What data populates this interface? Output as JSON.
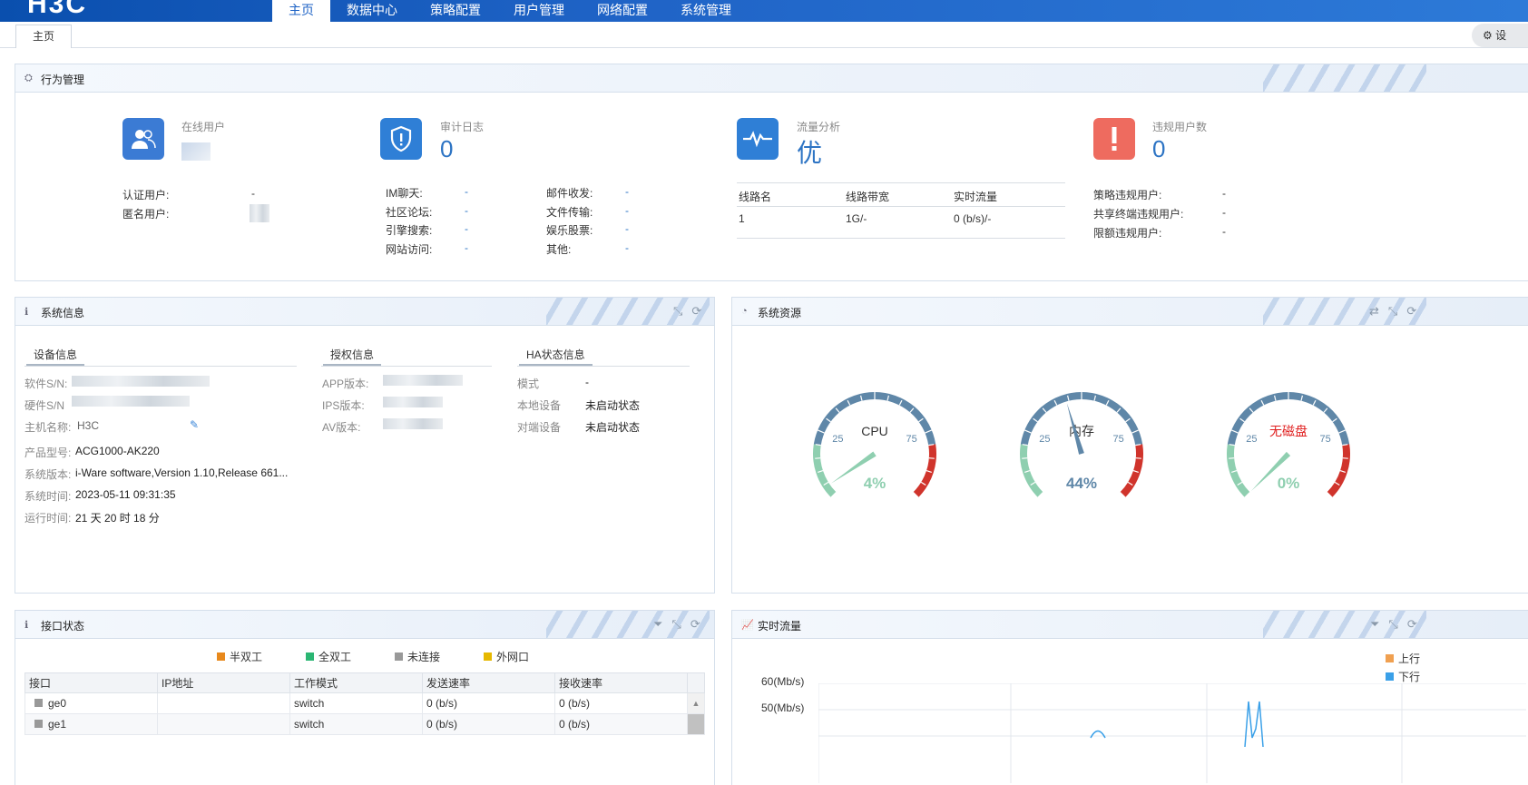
{
  "app": {
    "logo": "H3C"
  },
  "nav": {
    "items": [
      "主页",
      "数据中心",
      "策略配置",
      "用户管理",
      "网络配置",
      "系统管理"
    ],
    "active_index": 0
  },
  "tabs": {
    "current": "主页",
    "settings_label": "设"
  },
  "behavior": {
    "title": "行为管理",
    "online_users": {
      "label": "在线用户",
      "auth_label": "认证用户:",
      "auth_value": "-",
      "anon_label": "匿名用户:"
    },
    "audit": {
      "label": "审计日志",
      "value": "0",
      "items": [
        {
          "label": "IM聊天:",
          "value": "-"
        },
        {
          "label": "社区论坛:",
          "value": "-"
        },
        {
          "label": "引擎搜索:",
          "value": "-"
        },
        {
          "label": "网站访问:",
          "value": "-"
        },
        {
          "label": "邮件收发:",
          "value": "-"
        },
        {
          "label": "文件传输:",
          "value": "-"
        },
        {
          "label": "娱乐股票:",
          "value": "-"
        },
        {
          "label": "其他:",
          "value": "-"
        }
      ]
    },
    "traffic": {
      "label": "流量分析",
      "value": "优",
      "cols": [
        "线路名",
        "线路带宽",
        "实时流量"
      ],
      "row": [
        "1",
        "1G/-",
        "0 (b/s)/-"
      ]
    },
    "violations": {
      "label": "违规用户数",
      "value": "0",
      "items": [
        {
          "label": "策略违规用户:",
          "value": "-"
        },
        {
          "label": "共享终端违规用户:",
          "value": "-"
        },
        {
          "label": "限额违规用户:",
          "value": "-"
        }
      ]
    }
  },
  "sysinfo": {
    "title": "系统信息",
    "device_head": "设备信息",
    "license_head": "授权信息",
    "ha_head": "HA状态信息",
    "software_sn": "软件S/N:",
    "hardware_sn": "硬件S/N",
    "hostname_label": "主机名称:",
    "hostname": "H3C",
    "model_label": "产品型号:",
    "model": "ACG1000-AK220",
    "version_label": "系统版本:",
    "version": "i-Ware software,Version 1.10,Release 661...",
    "time_label": "系统时间:",
    "time": "2023-05-11 09:31:35",
    "uptime_label": "运行时间:",
    "uptime": "21 天 20 时 18 分",
    "app_label": "APP版本:",
    "ips_label": "IPS版本:",
    "av_label": "AV版本:",
    "mode_label": "模式",
    "mode": "-",
    "local_label": "本地设备",
    "local": "未启动状态",
    "peer_label": "对端设备",
    "peer": "未启动状态"
  },
  "resources": {
    "title": "系统资源",
    "gauges": [
      {
        "name": "CPU",
        "percent": 4,
        "label_color": "#333333",
        "value": "4%"
      },
      {
        "name": "内存",
        "percent": 44,
        "label_color": "#333333",
        "value": "44%"
      },
      {
        "name": "无磁盘",
        "percent": 0,
        "label_color": "#e02020",
        "value": "0%"
      }
    ],
    "tick_low": "25",
    "tick_high": "75"
  },
  "ports": {
    "title": "接口状态",
    "legend": [
      {
        "label": "半双工",
        "color": "#e8891c"
      },
      {
        "label": "全双工",
        "color": "#2bb673"
      },
      {
        "label": "未连接",
        "color": "#999999"
      },
      {
        "label": "外网口",
        "color": "#e6b800"
      }
    ],
    "cols": [
      "接口",
      "IP地址",
      "工作模式",
      "发送速率",
      "接收速率"
    ],
    "rows": [
      [
        "ge0",
        "",
        "switch",
        "0 (b/s)",
        "0 (b/s)"
      ],
      [
        "ge1",
        "",
        "switch",
        "0 (b/s)",
        "0 (b/s)"
      ]
    ]
  },
  "realtime": {
    "title": "实时流量",
    "legend": [
      {
        "label": "上行",
        "color": "#f0a050"
      },
      {
        "label": "下行",
        "color": "#3aa0e8"
      }
    ],
    "y_labels": [
      "60(Mb/s)",
      "50(Mb/s)"
    ]
  }
}
